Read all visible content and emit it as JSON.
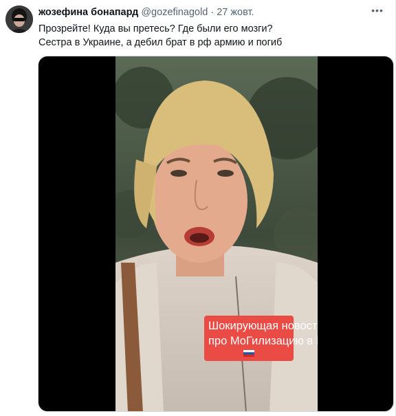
{
  "tweet": {
    "author_name": "жозефина бонапард",
    "handle": "@gozefinagold",
    "separator": "·",
    "date": "27 жовт.",
    "more_icon": "more-icon",
    "text_lines": [
      "Прозрейте! Куда вы претесь? Где были его мозги?",
      "Сестра в Украине, а дебил брат в рф армию и погиб"
    ]
  },
  "media": {
    "caption_lines": [
      "Шокирующая новость",
      "про МоГилизацию в РФ"
    ],
    "flag_icon": "russian-flag-icon"
  },
  "colors": {
    "caption_bg": "#ea4b45",
    "name": "#0f1419",
    "meta": "#536471"
  }
}
